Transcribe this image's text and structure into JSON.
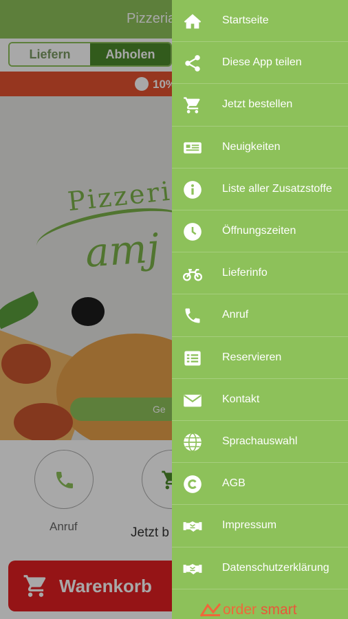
{
  "app": {
    "title": "Pizzeria",
    "toggle": {
      "deliver": "Liefern",
      "pickup": "Abholen"
    },
    "promo_text": "10%",
    "order_button_text": "Ge",
    "call_label": "Anruf",
    "order_label": "Jetzt b",
    "cart_label": "Warenkorb",
    "hero_logo": {
      "top": "Pizzeria",
      "script": "amj"
    }
  },
  "drawer": {
    "items": [
      {
        "label": "Startseite",
        "icon": "home-icon"
      },
      {
        "label": "Diese App teilen",
        "icon": "share-icon"
      },
      {
        "label": "Jetzt bestellen",
        "icon": "cart-icon"
      },
      {
        "label": "Neuigkeiten",
        "icon": "news-icon"
      },
      {
        "label": "Liste aller Zusatzstoffe",
        "icon": "info-icon"
      },
      {
        "label": "Öffnungszeiten",
        "icon": "clock-icon"
      },
      {
        "label": "Lieferinfo",
        "icon": "motorcycle-icon"
      },
      {
        "label": "Anruf",
        "icon": "phone-icon"
      },
      {
        "label": "Reservieren",
        "icon": "list-icon"
      },
      {
        "label": "Kontakt",
        "icon": "envelope-icon"
      },
      {
        "label": "Sprachauswahl",
        "icon": "globe-icon"
      },
      {
        "label": "AGB",
        "icon": "copyright-icon"
      },
      {
        "label": "Impressum",
        "icon": "handshake-icon"
      },
      {
        "label": "Datenschutzerklärung",
        "icon": "handshake-icon"
      }
    ],
    "brand": {
      "part1": "order",
      "part2": "smart"
    }
  },
  "colors": {
    "drawer": "#8dc15a",
    "cart": "#e21f22",
    "promo": "#e4522f",
    "brand": "#f0673a"
  }
}
